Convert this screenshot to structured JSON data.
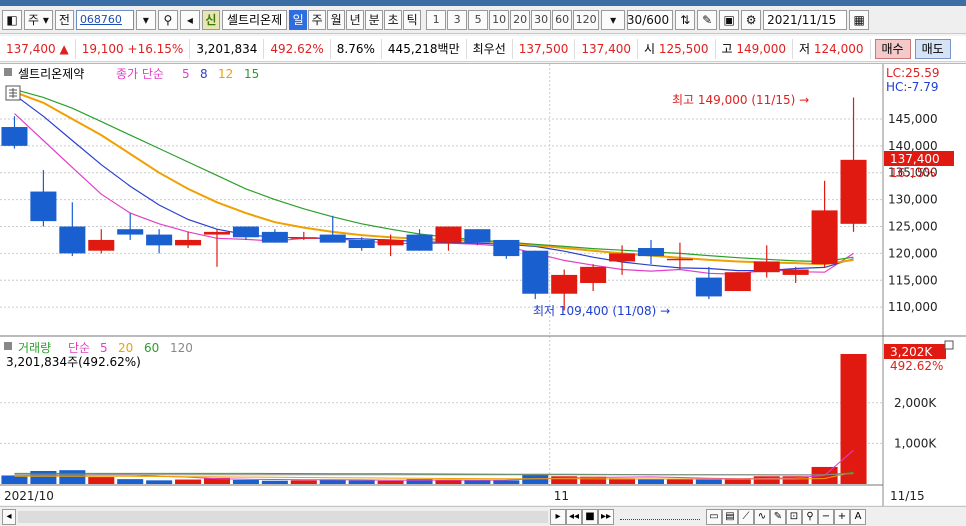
{
  "toolbar": {
    "market_label": "주",
    "jeon_label": "전",
    "stock_code": "068760",
    "sin_label": "신",
    "stock_name": "셀트리온제",
    "periods": [
      "일",
      "주",
      "월",
      "년",
      "분",
      "초",
      "틱"
    ],
    "active_period": "일",
    "tick_options": [
      "1",
      "3",
      "5",
      "10",
      "20",
      "30",
      "60",
      "120"
    ],
    "count_value": "30",
    "count_total": "/600",
    "date_value": "2021/11/15"
  },
  "quote": {
    "price": "137,400",
    "change_arrow": "▲",
    "change": "19,100",
    "change_pct": "+16.15%",
    "volume": "3,201,834",
    "volume_ratio": "492.62%",
    "turnover_pct": "8.76%",
    "amount": "445,218백만",
    "best_label": "최우선",
    "ask": "137,500",
    "bid": "137,400",
    "open_label": "시",
    "open": "125,500",
    "high_label": "고",
    "high": "149,000",
    "low_label": "저",
    "low": "124,000",
    "buy_label": "매수",
    "sell_label": "매도"
  },
  "legend": {
    "name": "셀트리온제약",
    "ma_prefix": "종가 단순",
    "ma_periods": [
      "5",
      "8",
      "12",
      "15"
    ],
    "ma_colors": [
      "#e040c8",
      "#2b3fd0",
      "#f0a000",
      "#2aa02a"
    ],
    "lc": "LC:25.59",
    "hc": "HC:-7.79"
  },
  "vol_legend": {
    "name": "거래량",
    "ma_prefix": "단순",
    "ma_periods": [
      "5",
      "20",
      "60",
      "120"
    ],
    "ma_colors": [
      "#e040c8",
      "#f0a000",
      "#2aa02a",
      "#888888"
    ],
    "current": "3,201,834주(492.62%)"
  },
  "annotations": {
    "high": "최고 149,000 (11/15) →",
    "low": "최저 109,400 (11/08) →"
  },
  "current_price_tag": {
    "price": "137,400",
    "pct": "16.15%"
  },
  "current_volume_tag": {
    "volume": "3,202K",
    "pct": "492.62%"
  },
  "colors": {
    "up": "#e01a10",
    "down": "#1a5fd0",
    "grid": "#cccccc"
  },
  "chart_data": {
    "type": "candlestick",
    "price_axis": {
      "ticks": [
        110000,
        115000,
        120000,
        125000,
        130000,
        135000,
        140000,
        145000
      ],
      "labels": [
        "110,000",
        "115,000",
        "120,000",
        "125,000",
        "130,000",
        "135,000",
        "140,000",
        "145,000"
      ],
      "range": [
        106500,
        151500
      ]
    },
    "volume_axis": {
      "ticks": [
        1000000,
        2000000
      ],
      "labels": [
        "1,000K",
        "2,000K"
      ],
      "range": [
        0,
        3300000
      ]
    },
    "x_labels": [
      {
        "label": "2021/10",
        "index": 0
      },
      {
        "label": "11",
        "index": 19
      },
      {
        "label": "11/15",
        "index": 30
      }
    ],
    "candles": [
      {
        "o": 143500,
        "h": 145500,
        "l": 139500,
        "c": 140000
      },
      {
        "o": 131500,
        "h": 135500,
        "l": 125000,
        "c": 126000
      },
      {
        "o": 125000,
        "h": 129500,
        "l": 119500,
        "c": 120000
      },
      {
        "o": 120500,
        "h": 124500,
        "l": 120000,
        "c": 122500
      },
      {
        "o": 124500,
        "h": 127500,
        "l": 122500,
        "c": 123500
      },
      {
        "o": 123500,
        "h": 124500,
        "l": 120000,
        "c": 121500
      },
      {
        "o": 121500,
        "h": 124000,
        "l": 121000,
        "c": 122500
      },
      {
        "o": 123500,
        "h": 124500,
        "l": 117500,
        "c": 124000
      },
      {
        "o": 125000,
        "h": 125000,
        "l": 122500,
        "c": 123000
      },
      {
        "o": 124000,
        "h": 124500,
        "l": 122000,
        "c": 122000
      },
      {
        "o": 123000,
        "h": 124000,
        "l": 122500,
        "c": 123000
      },
      {
        "o": 123500,
        "h": 127000,
        "l": 122500,
        "c": 122000
      },
      {
        "o": 122500,
        "h": 123000,
        "l": 120500,
        "c": 121000
      },
      {
        "o": 121500,
        "h": 123500,
        "l": 119500,
        "c": 122500
      },
      {
        "o": 123500,
        "h": 124500,
        "l": 120500,
        "c": 120500
      },
      {
        "o": 122000,
        "h": 125000,
        "l": 120500,
        "c": 125000
      },
      {
        "o": 124500,
        "h": 124500,
        "l": 121500,
        "c": 122000
      },
      {
        "o": 122500,
        "h": 122500,
        "l": 119000,
        "c": 119500
      },
      {
        "o": 120500,
        "h": 120500,
        "l": 111500,
        "c": 112500
      },
      {
        "o": 112500,
        "h": 117000,
        "l": 109400,
        "c": 116000
      },
      {
        "o": 114500,
        "h": 118000,
        "l": 113000,
        "c": 117500
      },
      {
        "o": 118500,
        "h": 121500,
        "l": 116000,
        "c": 120000
      },
      {
        "o": 121000,
        "h": 122500,
        "l": 118000,
        "c": 119500
      },
      {
        "o": 119000,
        "h": 122000,
        "l": 117000,
        "c": 119000
      },
      {
        "o": 115500,
        "h": 117500,
        "l": 111500,
        "c": 112000
      },
      {
        "o": 113000,
        "h": 116500,
        "l": 113000,
        "c": 116500
      },
      {
        "o": 116500,
        "h": 121500,
        "l": 115500,
        "c": 118500
      },
      {
        "o": 116000,
        "h": 117500,
        "l": 114500,
        "c": 117000
      },
      {
        "o": 118000,
        "h": 133500,
        "l": 117500,
        "c": 128000
      },
      {
        "o": 125500,
        "h": 149000,
        "l": 124000,
        "c": 137400
      }
    ],
    "volumes": [
      210000,
      320000,
      340000,
      170000,
      120000,
      90000,
      110000,
      150000,
      100000,
      80000,
      90000,
      100000,
      90000,
      80000,
      120000,
      100000,
      90000,
      90000,
      230000,
      190000,
      180000,
      140000,
      120000,
      130000,
      110000,
      140000,
      190000,
      190000,
      420000,
      3201834
    ],
    "ma_price": [
      {
        "name": "5",
        "color": "#e040c8",
        "values": [
          146000,
          141000,
          136000,
          131000,
          127500,
          125500,
          124000,
          122800,
          122600,
          122300,
          122800,
          122800,
          122300,
          121900,
          121800,
          121900,
          121700,
          121300,
          120000,
          118700,
          117800,
          117000,
          116700,
          117000,
          116300,
          116100,
          117000,
          116600,
          116500,
          120000
        ]
      },
      {
        "name": "8",
        "color": "#2b3fd0",
        "values": [
          149500,
          145500,
          141000,
          136500,
          132500,
          129000,
          126300,
          124500,
          123500,
          123000,
          122900,
          122800,
          122700,
          122500,
          122200,
          122000,
          121900,
          121700,
          121300,
          120400,
          119300,
          118400,
          117800,
          117300,
          117200,
          116800,
          116800,
          117200,
          117400,
          119000
        ]
      },
      {
        "name": "12",
        "color": "#f0a000",
        "values": [
          150000,
          148000,
          145000,
          142000,
          138500,
          135000,
          132000,
          129500,
          127500,
          125800,
          124800,
          124000,
          123400,
          123000,
          122700,
          122500,
          122300,
          122000,
          121500,
          121000,
          120500,
          120000,
          119600,
          119200,
          118800,
          118500,
          118300,
          118200,
          118000,
          118800
        ]
      },
      {
        "name": "15",
        "color": "#2aa02a",
        "values": [
          150500,
          149000,
          147000,
          144500,
          142000,
          139500,
          137000,
          134500,
          132000,
          130000,
          128300,
          126800,
          125500,
          124500,
          123600,
          123000,
          122500,
          122100,
          121700,
          121300,
          120900,
          120600,
          120300,
          120000,
          119600,
          119200,
          118900,
          118600,
          118500,
          119300
        ]
      }
    ],
    "ma_volume": [
      {
        "name": "5",
        "color": "#e040c8",
        "values": [
          200000,
          210000,
          220000,
          230000,
          230000,
          190000,
          170000,
          130000,
          115000,
          110000,
          105000,
          105000,
          100000,
          90000,
          95000,
          98000,
          96000,
          98000,
          125000,
          145000,
          160000,
          170000,
          175000,
          160000,
          140000,
          128000,
          138000,
          150000,
          212000,
          830000
        ]
      },
      {
        "name": "20",
        "color": "#f0a000",
        "values": [
          190000,
          190000,
          190000,
          190000,
          190000,
          185000,
          180000,
          175000,
          170000,
          165000,
          160000,
          155000,
          150000,
          145000,
          140000,
          135000,
          132000,
          130000,
          130000,
          128000,
          126000,
          124000,
          122000,
          122000,
          121000,
          121000,
          122000,
          124000,
          136000,
          290000
        ]
      },
      {
        "name": "60",
        "color": "#2aa02a",
        "values": [
          260000,
          260000,
          260000,
          260000,
          260000,
          260000,
          260000,
          260000,
          260000,
          258000,
          256000,
          254000,
          252000,
          250000,
          248000,
          246000,
          244000,
          242000,
          240000,
          238000,
          236000,
          234000,
          232000,
          230000,
          228000,
          226000,
          224000,
          222000,
          224000,
          280000
        ]
      },
      {
        "name": "120",
        "color": "#888888",
        "values": [
          230000,
          230000,
          230000,
          230000,
          230000,
          230000,
          230000,
          230000,
          230000,
          230000,
          230000,
          230000,
          230000,
          230000,
          230000,
          230000,
          230000,
          230000,
          230000,
          230000,
          230000,
          230000,
          230000,
          230000,
          230000,
          230000,
          230000,
          230000,
          230000,
          255000
        ]
      }
    ]
  }
}
